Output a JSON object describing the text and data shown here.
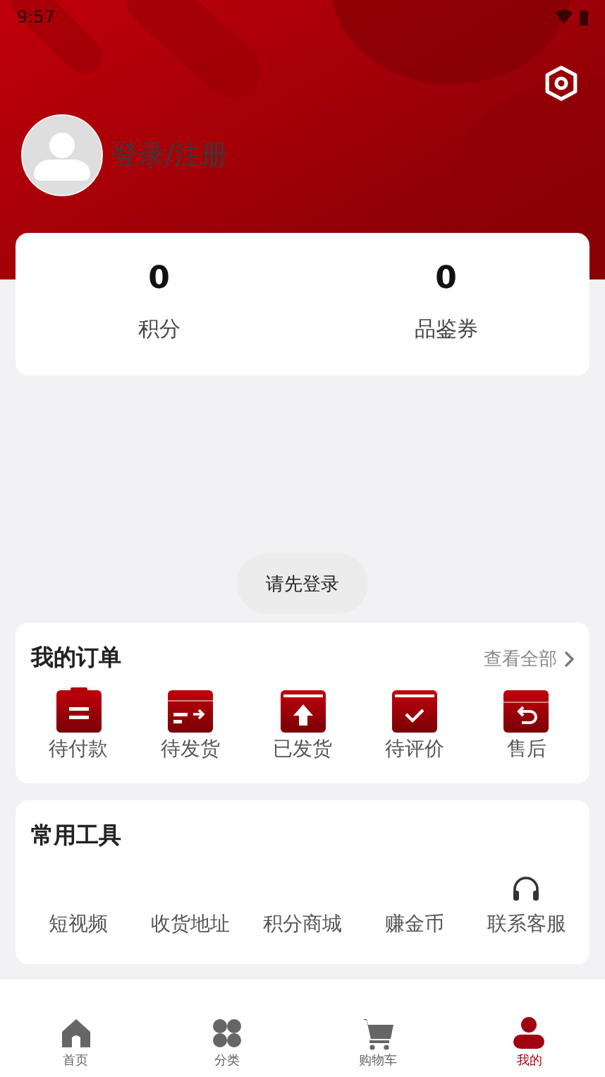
{
  "status_bar": {
    "time": "9:57"
  },
  "profile": {
    "login_text": "登录/注册"
  },
  "stats": [
    {
      "value": "0",
      "label": "积分"
    },
    {
      "value": "0",
      "label": "品鉴券"
    }
  ],
  "toast": "请先登录",
  "orders": {
    "title": "我的订单",
    "view_all": "查看全部",
    "items": [
      {
        "kind": "pay",
        "label": "待付款"
      },
      {
        "kind": "ship",
        "label": "待发货"
      },
      {
        "kind": "shipped",
        "label": "已发货"
      },
      {
        "kind": "review",
        "label": "待评价"
      },
      {
        "kind": "aftersale",
        "label": "售后"
      }
    ]
  },
  "tools": {
    "title": "常用工具",
    "items": [
      {
        "kind": "blank",
        "label": "短视频"
      },
      {
        "kind": "blank",
        "label": "收货地址"
      },
      {
        "kind": "blank",
        "label": "积分商城"
      },
      {
        "kind": "blank",
        "label": "赚金币"
      },
      {
        "kind": "headset",
        "label": "联系客服"
      }
    ]
  },
  "tabs": [
    {
      "kind": "home",
      "label": "首页",
      "selected": false
    },
    {
      "kind": "category",
      "label": "分类",
      "selected": false
    },
    {
      "kind": "cart",
      "label": "购物车",
      "selected": false
    },
    {
      "kind": "me",
      "label": "我的",
      "selected": true
    }
  ]
}
